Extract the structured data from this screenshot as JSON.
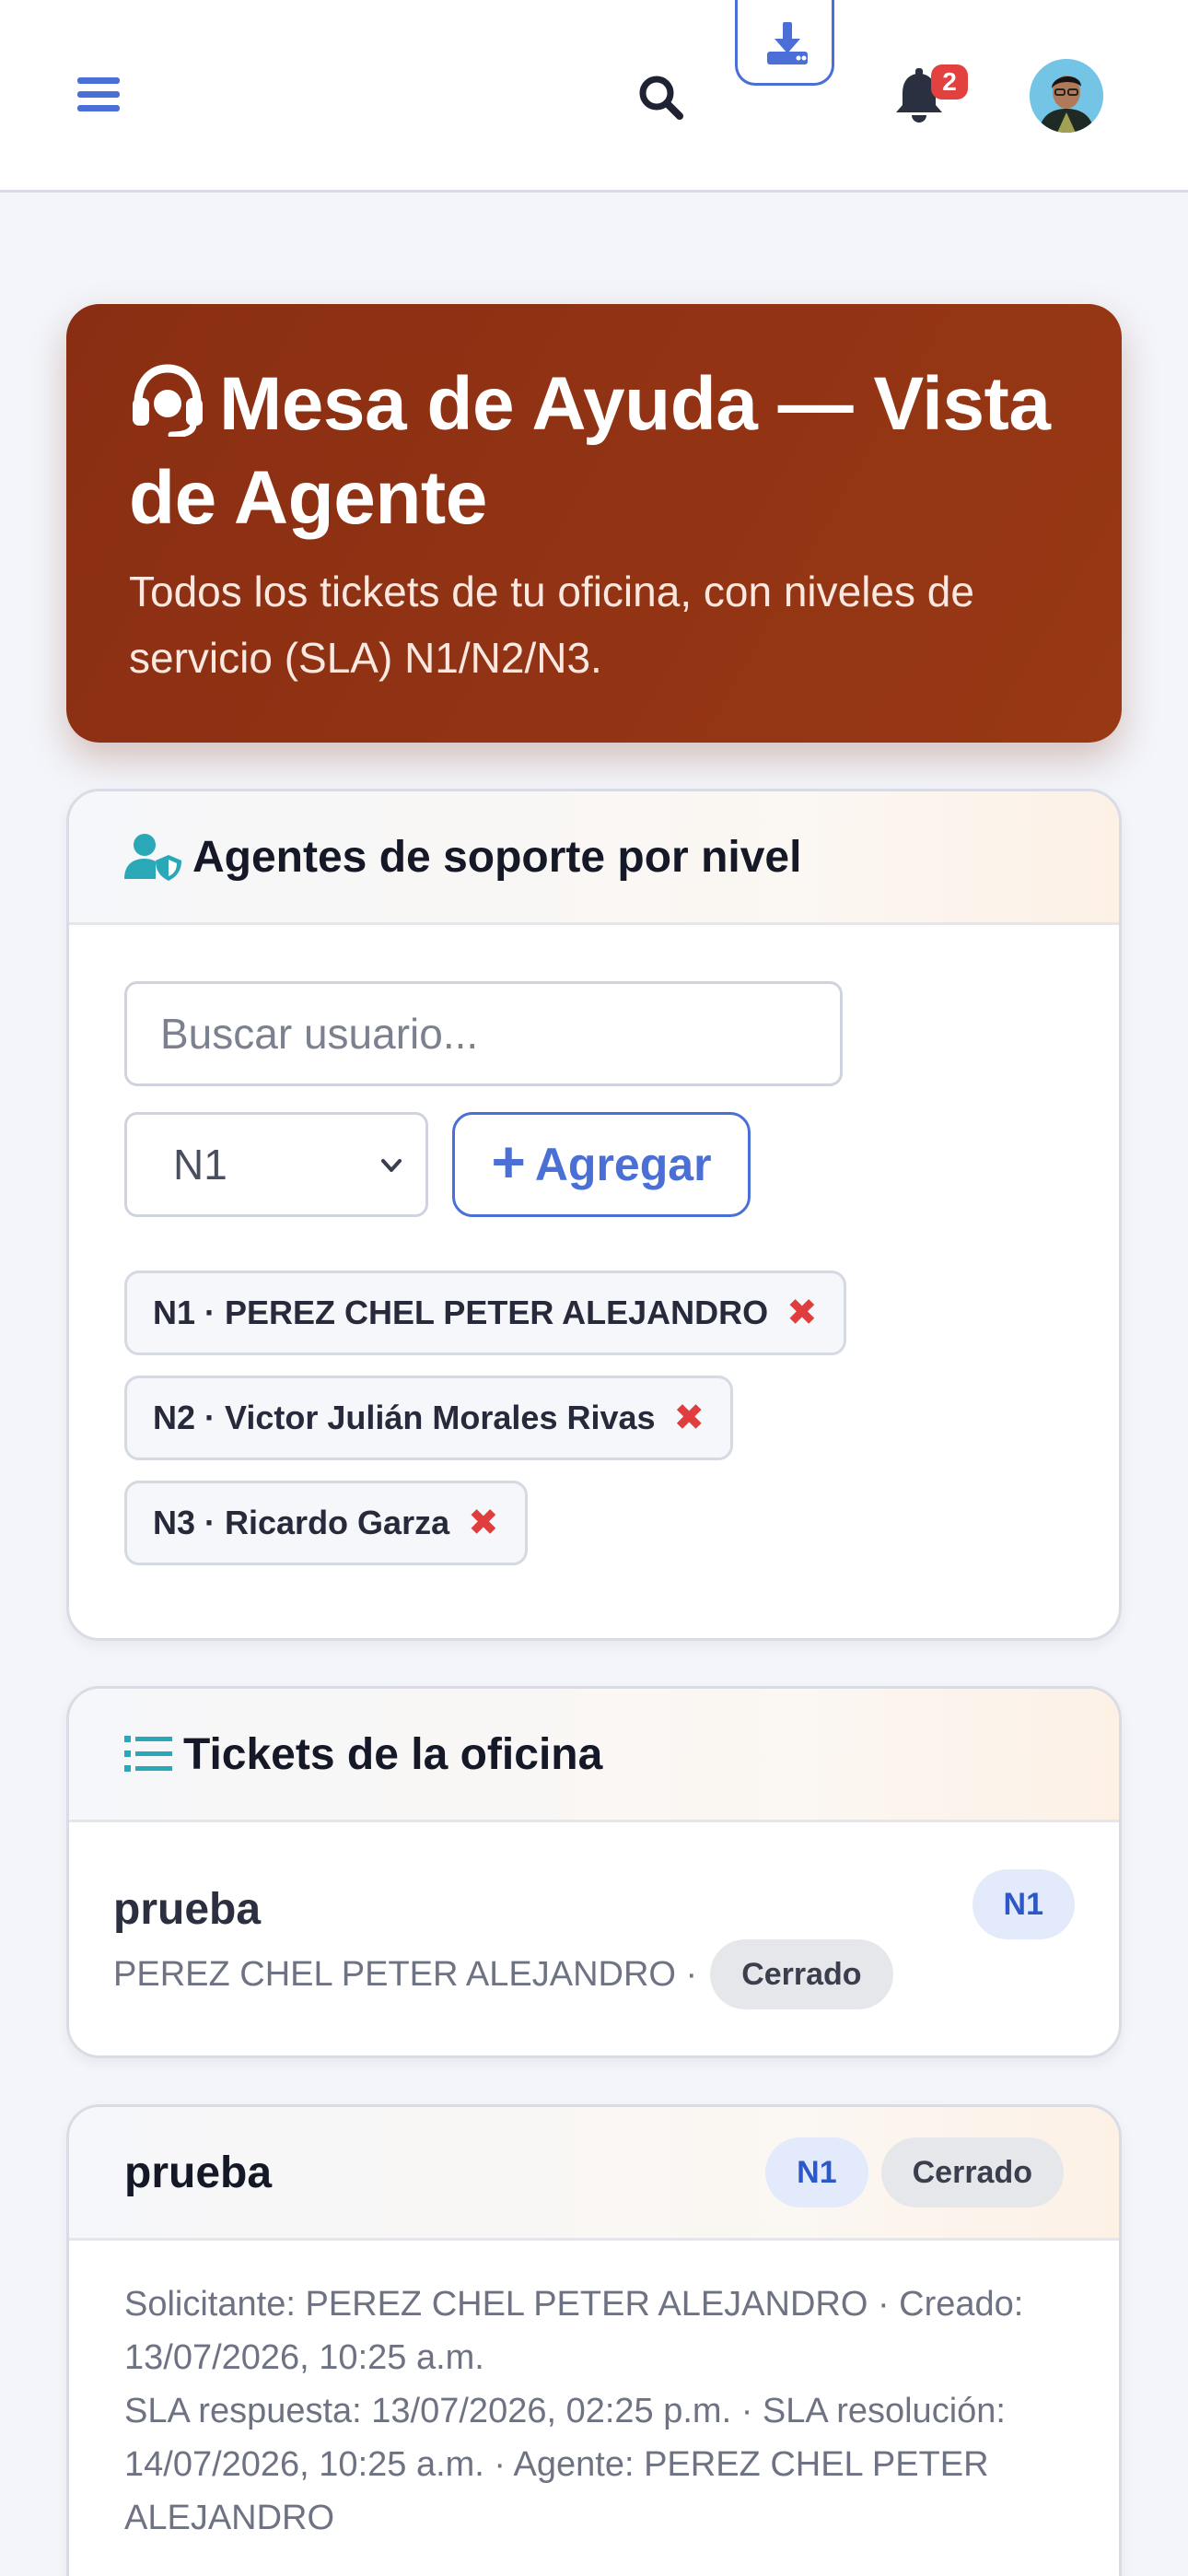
{
  "topbar": {
    "menu_icon": "hamburger-icon",
    "search_icon": "search-icon",
    "download_icon": "download-icon",
    "notifications_icon": "bell-icon",
    "notifications_count": "2",
    "avatar": "user-avatar"
  },
  "hero": {
    "icon": "headset-icon",
    "title": "Mesa de Ayuda — Vista de Agente",
    "subtitle": "Todos los tickets de tu oficina, con niveles de servicio (SLA) N1/N2/N3."
  },
  "agents": {
    "title": "Agentes de soporte por nivel",
    "icon": "user-shield-icon",
    "search_placeholder": "Buscar usuario...",
    "search_value": "",
    "level_selected": "N1",
    "add_label": "Agregar",
    "chips": [
      {
        "label": "N1 · PEREZ CHEL PETER ALEJANDRO"
      },
      {
        "label": "N2 · Victor Julián Morales Rivas"
      },
      {
        "label": "N3 · Ricardo Garza"
      }
    ]
  },
  "tickets": {
    "title": "Tickets de la oficina",
    "icon": "list-icon",
    "items": [
      {
        "title": "prueba",
        "requester": "PEREZ CHEL PETER ALEJANDRO ·",
        "status": "Cerrado",
        "level": "N1"
      }
    ]
  },
  "detail": {
    "title": "prueba",
    "level": "N1",
    "status": "Cerrado",
    "line1": "Solicitante: PEREZ CHEL PETER ALEJANDRO · Creado: 13/07/2026, 10:25 a.m.",
    "line2": "SLA respuesta: 13/07/2026, 02:25 p.m. · SLA resolución: 14/07/2026, 10:25 a.m. · Agente: PEREZ CHEL PETER ALEJANDRO"
  },
  "colors": {
    "accent": "#4a6fd6",
    "hero_bg": "#8a2e13",
    "badge_red": "#e34040",
    "teal_icon": "#2aa8b8"
  }
}
